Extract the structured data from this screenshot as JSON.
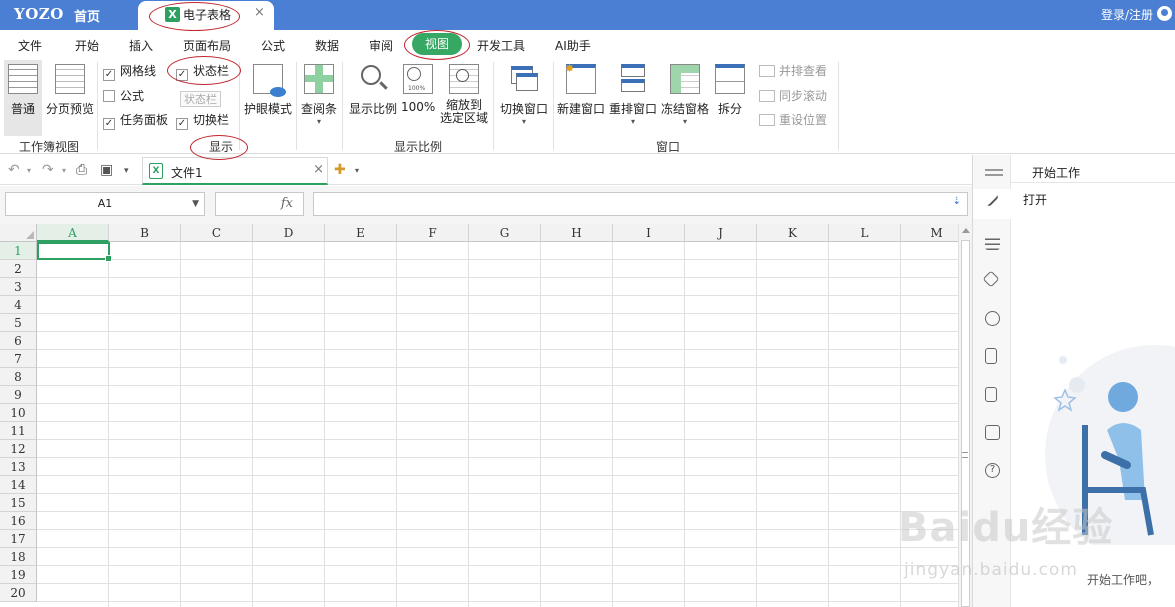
{
  "titlebar": {
    "logo": "YOZO",
    "home": "首页",
    "tab_label": "电子表格",
    "tab_close": "×",
    "login": "登录/注册"
  },
  "menu": [
    "文件",
    "开始",
    "插入",
    "页面布局",
    "公式",
    "数据",
    "审阅",
    "视图",
    "开发工具",
    "AI助手"
  ],
  "active_menu": "视图",
  "ribbon": {
    "workbook_view": {
      "normal": "普通",
      "page_preview": "分页预览",
      "label": "工作簿视图"
    },
    "show": {
      "gridlines": {
        "label": "网格线",
        "checked": true
      },
      "formula": {
        "label": "公式",
        "checked": false
      },
      "task_pane": {
        "label": "任务面板",
        "checked": true
      },
      "status_bar": {
        "label": "状态栏",
        "checked": true
      },
      "status_bar_tooltip": "状态栏",
      "switch_bar": {
        "label": "切换栏",
        "checked": true
      },
      "label": "显示"
    },
    "eye_mode": "护眼模式",
    "reading_bar": "查阅条",
    "zoom": {
      "show_ratio": "显示比例",
      "hundred": "100%",
      "zoom_selection_line1": "缩放到",
      "zoom_selection_line2": "选定区域",
      "label": "显示比例"
    },
    "switch_window": "切换窗口",
    "window": {
      "new_window": "新建窗口",
      "rearrange": "重排窗口",
      "freeze": "冻结窗格",
      "split": "拆分",
      "side_by_side": "并排查看",
      "sync_scroll": "同步滚动",
      "reset_position": "重设位置",
      "label": "窗口"
    }
  },
  "document_tab": {
    "name": "文件1",
    "close": "×"
  },
  "formula_bar": {
    "name_box": "A1",
    "fx": "fx",
    "content": ""
  },
  "sheet": {
    "columns": [
      "A",
      "B",
      "C",
      "D",
      "E",
      "F",
      "G",
      "H",
      "I",
      "J",
      "K",
      "L",
      "M"
    ],
    "rows": [
      "1",
      "2",
      "3",
      "4",
      "5",
      "6",
      "7",
      "8",
      "9",
      "10",
      "11",
      "12",
      "13",
      "14",
      "15",
      "16",
      "17",
      "18",
      "19",
      "20"
    ],
    "active_cell": "A1"
  },
  "task_pane": {
    "title": "开始工作",
    "open": "打开",
    "footer": "开始工作吧，"
  },
  "watermark": {
    "line1": "Baidu经验",
    "line2": "jingyan.baidu.com"
  },
  "colors": {
    "titlebar": "#4a7fd4",
    "accent_green": "#36a864",
    "annotation_red": "#c0262d"
  }
}
